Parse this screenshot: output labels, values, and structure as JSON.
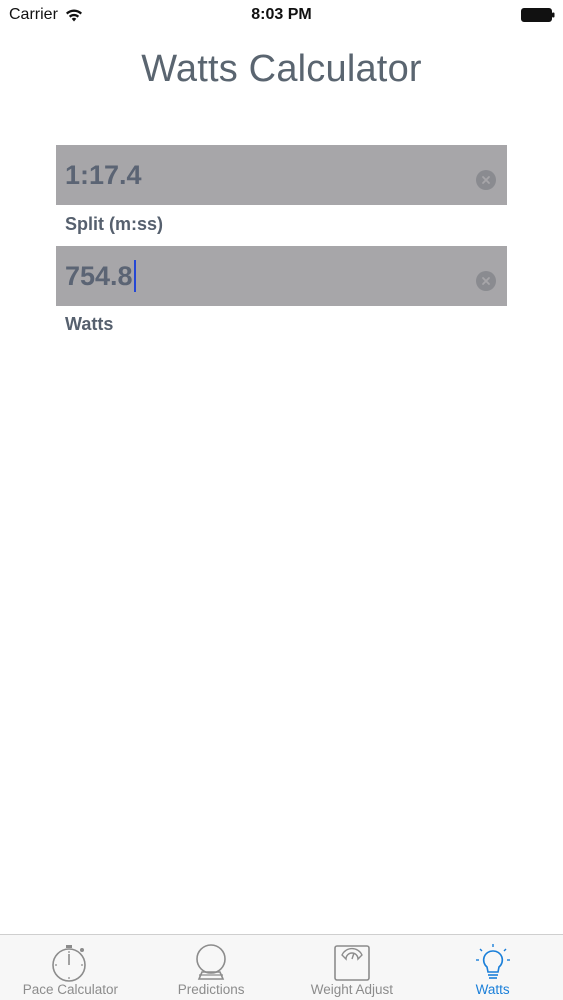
{
  "status_bar": {
    "carrier": "Carrier",
    "time": "8:03 PM"
  },
  "page": {
    "title": "Watts Calculator"
  },
  "fields": [
    {
      "value": "1:17.4",
      "label": "Split (m:ss)"
    },
    {
      "value": "754.8",
      "label": "Watts"
    }
  ],
  "tabs": [
    {
      "label": "Pace Calculator",
      "icon": "stopwatch-icon"
    },
    {
      "label": "Predictions",
      "icon": "crystal-ball-icon"
    },
    {
      "label": "Weight Adjust",
      "icon": "scale-icon"
    },
    {
      "label": "Watts",
      "icon": "lightbulb-icon"
    }
  ],
  "colors": {
    "field_background": "#a7a6a9",
    "field_text": "#5b6474",
    "caret": "#2447d6",
    "active_tab": "#1a7fd9",
    "inactive_tab": "#8c8c8c",
    "title": "#5a6570"
  }
}
